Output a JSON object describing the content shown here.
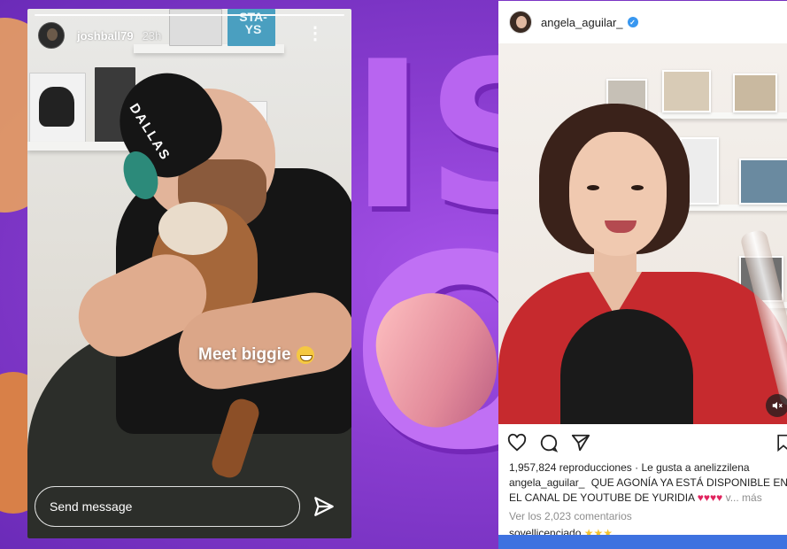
{
  "story": {
    "username": "joshball79",
    "time": "23h",
    "more_label": "⋮",
    "caption": "Meet biggie",
    "cap_text": "DALLAS",
    "book_label": "STA-YS",
    "send_placeholder": "Send message"
  },
  "post": {
    "username": "angela_aguilar_",
    "verified_label": "✓",
    "views": "1,957,824 reproducciones",
    "likes_text": "· Le gusta a anelizzilena",
    "caption_user": "angela_aguilar_",
    "caption_text": "QUE AGONÍA YA ESTÁ DISPONIBLE EN EL CANAL DE YOUTUBE DE YURIDIA",
    "caption_hearts": "♥♥♥♥",
    "more_label": "v... más",
    "comments_label": "Ver los 2,023 comentarios",
    "commenter": "soyellicenciado",
    "commenter_stars": "★★★"
  },
  "icons": {
    "like": "heart-icon",
    "comment": "comment-icon",
    "share": "paper-plane-icon",
    "save": "bookmark-icon",
    "mute": "speaker-muted-icon"
  },
  "colors": {
    "background_purple": "#8e3fd0",
    "verified_blue": "#3897f0",
    "heart_red": "#e0245e"
  }
}
